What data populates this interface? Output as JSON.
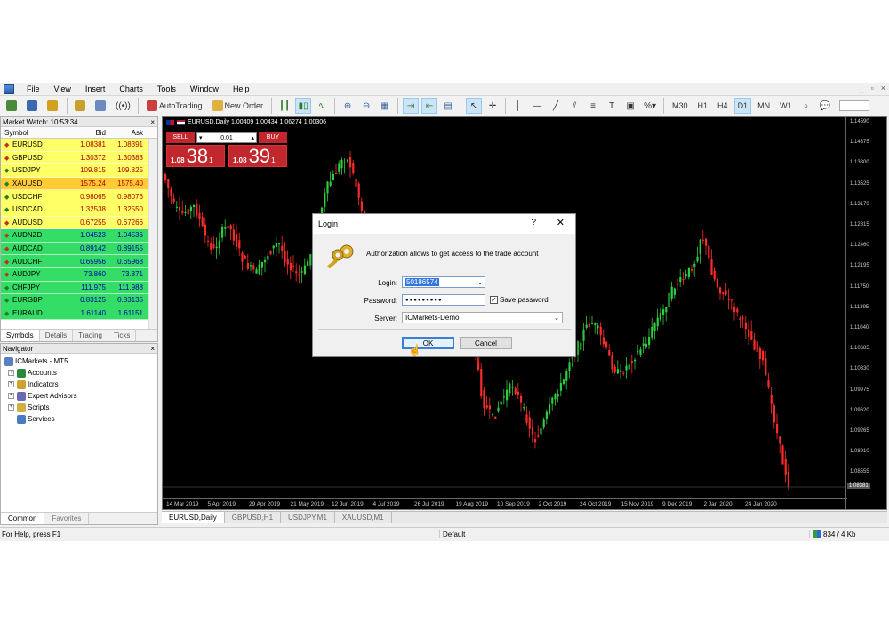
{
  "menu": [
    "File",
    "View",
    "Insert",
    "Charts",
    "Tools",
    "Window",
    "Help"
  ],
  "window_controls": [
    "_",
    "▫",
    "×"
  ],
  "toolbar": {
    "autotrading": "AutoTrading",
    "new_order": "New Order",
    "timeframes": [
      "M30",
      "H1",
      "H4",
      "D1",
      "MN",
      "W1"
    ],
    "active_timeframe": "D1"
  },
  "market_watch": {
    "title": "Market Watch: 10:53:34",
    "close": "×",
    "headers": {
      "symbol": "Symbol",
      "bid": "Bid",
      "ask": "Ask"
    },
    "rows": [
      {
        "symbol": "EURUSD",
        "bid": "1.08381",
        "ask": "1.08391",
        "color": "#ffff66",
        "dir": "up"
      },
      {
        "symbol": "GBPUSD",
        "bid": "1.30372",
        "ask": "1.30383",
        "color": "#ffff66",
        "dir": "up"
      },
      {
        "symbol": "USDJPY",
        "bid": "109.815",
        "ask": "109.825",
        "color": "#ffff66",
        "dir": "down"
      },
      {
        "symbol": "XAUUSD",
        "bid": "1575.24",
        "ask": "1575.40",
        "color": "#ffcc33",
        "dir": "down"
      },
      {
        "symbol": "USDCHF",
        "bid": "0.98065",
        "ask": "0.98076",
        "color": "#ffff66",
        "dir": "down"
      },
      {
        "symbol": "USDCAD",
        "bid": "1.32538",
        "ask": "1.32550",
        "color": "#ffff66",
        "dir": "down"
      },
      {
        "symbol": "AUDUSD",
        "bid": "0.67255",
        "ask": "0.67266",
        "color": "#ffff66",
        "dir": "up"
      },
      {
        "symbol": "AUDNZD",
        "bid": "1.04523",
        "ask": "1.04536",
        "color": "#33dd66",
        "dir": "up"
      },
      {
        "symbol": "AUDCAD",
        "bid": "0.89142",
        "ask": "0.89155",
        "color": "#33dd66",
        "dir": "up"
      },
      {
        "symbol": "AUDCHF",
        "bid": "0.65956",
        "ask": "0.65968",
        "color": "#33dd66",
        "dir": "up"
      },
      {
        "symbol": "AUDJPY",
        "bid": "73.860",
        "ask": "73.871",
        "color": "#33dd66",
        "dir": "up"
      },
      {
        "symbol": "CHFJPY",
        "bid": "111.975",
        "ask": "111.988",
        "color": "#33dd66",
        "dir": "down"
      },
      {
        "symbol": "EURGBP",
        "bid": "0.83125",
        "ask": "0.83135",
        "color": "#33dd66",
        "dir": "down"
      },
      {
        "symbol": "EURAUD",
        "bid": "1.61140",
        "ask": "1.61151",
        "color": "#33dd66",
        "dir": "down"
      }
    ],
    "tabs": [
      "Symbols",
      "Details",
      "Trading",
      "Ticks"
    ]
  },
  "navigator": {
    "title": "Navigator",
    "close": "×",
    "root": "ICMarkets - MT5",
    "items": [
      "Accounts",
      "Indicators",
      "Expert Advisors",
      "Scripts",
      "Services"
    ],
    "tabs": [
      "Common",
      "Favorites"
    ]
  },
  "chart": {
    "info": "EURUSD,Daily  1.00409 1.00434 1.06274 1.00306",
    "sell_label": "SELL",
    "buy_label": "BUY",
    "volume": "0.01",
    "sell_small": "1.08",
    "sell_big": "38",
    "sell_sup": "1",
    "buy_small": "1.08",
    "buy_big": "39",
    "buy_sup": "1",
    "price_labels": [
      "1.14590",
      "1.14375",
      "1.13800",
      "1.13525",
      "1.13170",
      "1.12815",
      "1.12460",
      "1.12195",
      "1.11750",
      "1.11395",
      "1.11040",
      "1.10685",
      "1.10330",
      "1.09975",
      "1.09620",
      "1.09265",
      "1.08910",
      "1.08555"
    ],
    "current_price": "1.08381",
    "date_labels": [
      "14 Mar 2019",
      "5 Apr 2019",
      "29 Apr 2019",
      "21 May 2019",
      "12 Jun 2019",
      "4 Jul 2019",
      "26 Jul 2019",
      "19 Aug 2019",
      "10 Sep 2019",
      "2 Oct 2019",
      "24 Oct 2019",
      "15 Nov 2019",
      "9 Dec 2019",
      "2 Jan 2020",
      "24 Jan 2020"
    ],
    "tabs": [
      "EURUSD,Daily",
      "GBPUSD,H1",
      "USDJPY,M1",
      "XAUUSD,M1"
    ]
  },
  "login_dialog": {
    "title": "Login",
    "help": "?",
    "close": "✕",
    "message": "Authorization allows to get access to the trade account",
    "login_label": "Login:",
    "login_value": "50186574",
    "password_label": "Password:",
    "password_value": "●●●●●●●●●",
    "save_password": "Save password",
    "save_checked": true,
    "server_label": "Server:",
    "server_value": "ICMarkets-Demo",
    "ok": "OK",
    "cancel": "Cancel"
  },
  "status": {
    "help": "For Help, press F1",
    "profile": "Default",
    "traffic": "834 / 4 Kb"
  }
}
